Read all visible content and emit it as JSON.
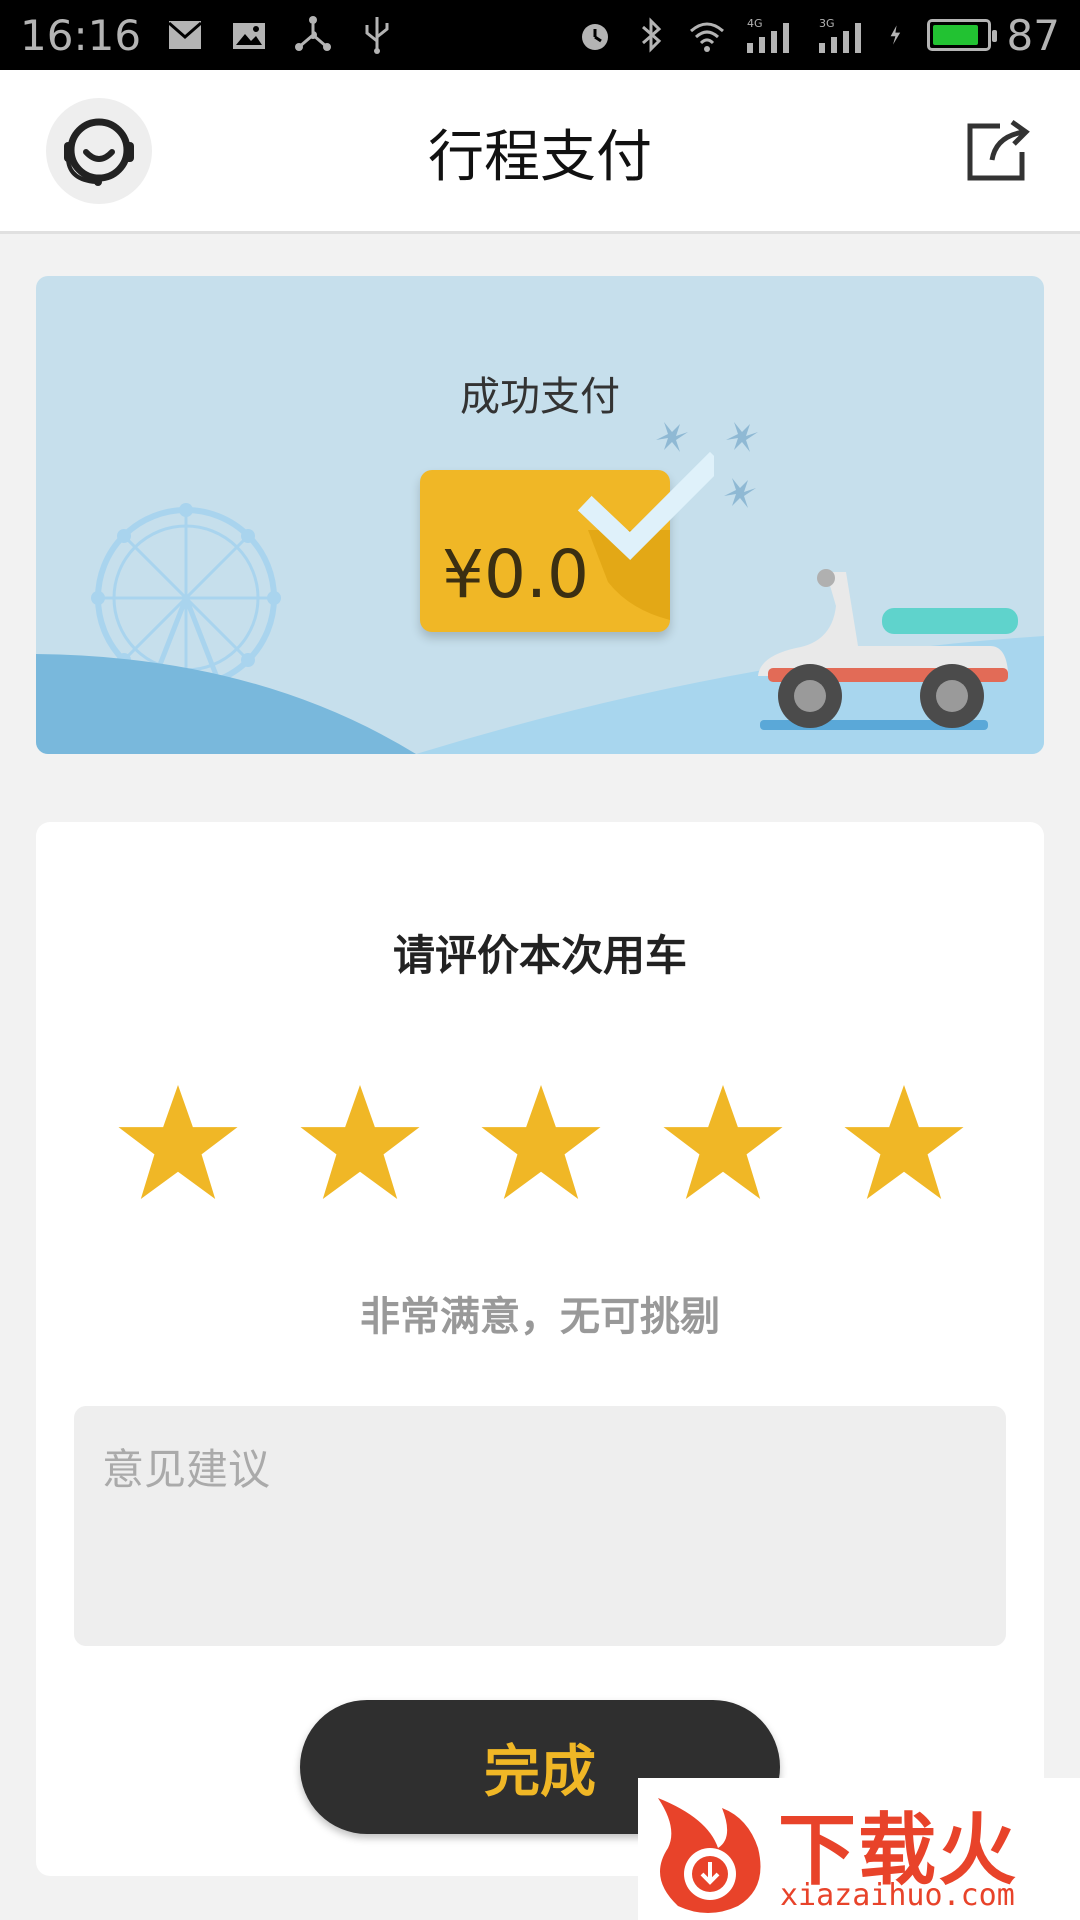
{
  "status_bar": {
    "time": "16:16",
    "battery_level": "87",
    "battery_fraction": 0.87,
    "left_icons": [
      "mail-icon",
      "image-icon",
      "share-network-icon",
      "usb-icon"
    ],
    "right_icons": [
      "alarm-icon",
      "bluetooth-icon",
      "wifi-icon",
      "signal-4g-icon",
      "signal-3g-icon",
      "charging-icon",
      "battery-icon"
    ],
    "signal_labels": [
      "4G",
      "3G"
    ]
  },
  "nav": {
    "title": "行程支付",
    "left_icon": "customer-service-icon",
    "right_icon": "share-icon"
  },
  "payment": {
    "status": "成功支付",
    "amount": "¥0.0"
  },
  "rating": {
    "title": "请评价本次用车",
    "stars": 5,
    "max_stars": 5,
    "star_color": "#f0b726",
    "description": "非常满意，无可挑剔",
    "feedback_placeholder": "意见建议",
    "done_label": "完成"
  },
  "watermark": {
    "brand": "下载火",
    "url": "xiazaihuo.com"
  },
  "colors": {
    "accent": "#f0b726",
    "button_bg": "#2f2f2f",
    "card_bg": "#c6dfec"
  }
}
